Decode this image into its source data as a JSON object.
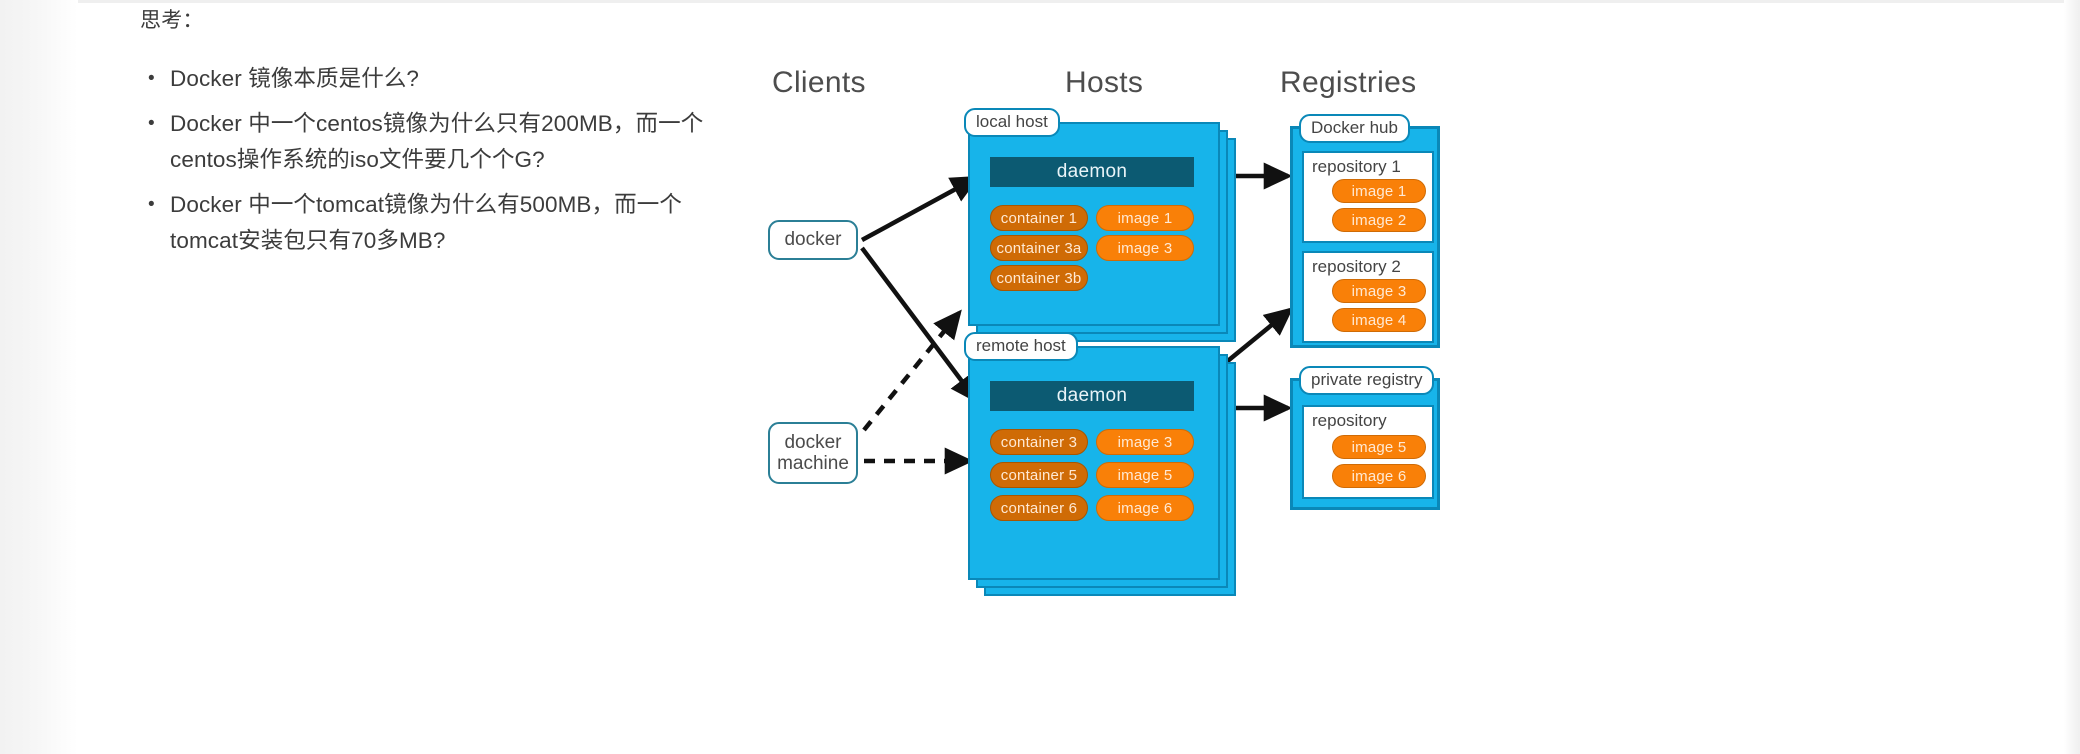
{
  "slide": {
    "prompt_label": "思考：",
    "bullets": [
      {
        "line1": "Docker 镜像本质是什么?",
        "line2": ""
      },
      {
        "line1": "Docker 中一个centos镜像为什么只有200MB，而一个",
        "line2": "centos操作系统的iso文件要几个个G?"
      },
      {
        "line1": "Docker 中一个tomcat镜像为什么有500MB，而一个",
        "line2": "tomcat安装包只有70多MB?"
      }
    ],
    "bullet_marker": "•"
  },
  "diagram": {
    "columns": {
      "clients": "Clients",
      "hosts": "Hosts",
      "registries": "Registries"
    },
    "clients": [
      {
        "id": "docker",
        "label": "docker"
      },
      {
        "id": "docker-machine",
        "line1": "docker",
        "line2": "machine"
      }
    ],
    "hosts": [
      {
        "tag": "local host",
        "daemon": "daemon",
        "containers": [
          "container 1",
          "container 3a",
          "container 3b"
        ],
        "images": [
          "image 1",
          "image 3"
        ]
      },
      {
        "tag": "remote host",
        "daemon": "daemon",
        "containers": [
          "container 3",
          "container 5",
          "container 6"
        ],
        "images": [
          "image 3",
          "image 5",
          "image 6"
        ]
      }
    ],
    "registries": [
      {
        "tag": "Docker hub",
        "repositories": [
          {
            "label": "repository 1",
            "images": [
              "image 1",
              "image 2"
            ]
          },
          {
            "label": "repository 2",
            "images": [
              "image 3",
              "image 4"
            ]
          }
        ]
      },
      {
        "tag": "private registry",
        "repositories": [
          {
            "label": "repository",
            "images": [
              "image 5",
              "image 6"
            ]
          }
        ]
      }
    ],
    "colors": {
      "host_fill": "#17b4ea",
      "host_border": "#0a88b8",
      "daemon_fill": "#0c5a72",
      "container_fill": "#cf6b06",
      "image_fill": "#f98008",
      "pill_border": "#2b7f96",
      "heading_text": "#4d4d4d"
    }
  }
}
